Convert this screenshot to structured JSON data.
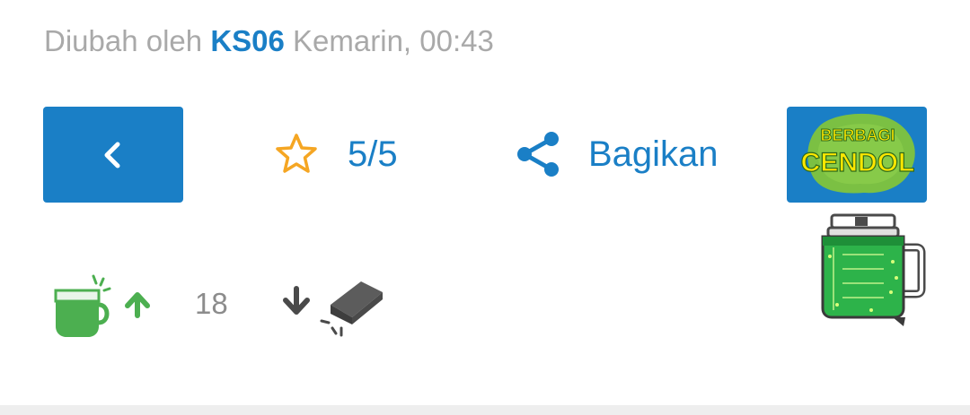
{
  "meta": {
    "prefix": "Diubah oleh",
    "user": "KS06",
    "time": "Kemarin, 00:43"
  },
  "actions": {
    "back_icon": "chevron-left-icon",
    "rating": {
      "icon": "star-outline-icon",
      "value": "5/5"
    },
    "share": {
      "icon": "share-icon",
      "label": "Bagikan"
    },
    "cendol": {
      "line1": "BERBAGI",
      "line2": "CENDOL"
    }
  },
  "votes": {
    "count": "18",
    "upvote_icon": "cup-arrow-up-icon",
    "downvote_icon": "eraser-arrow-down-icon"
  },
  "colors": {
    "primary": "#1a7fc6",
    "star": "#f5a623",
    "green": "#4caf50",
    "muted": "#a9a9a9",
    "grey_icon": "#4a4a4a"
  }
}
